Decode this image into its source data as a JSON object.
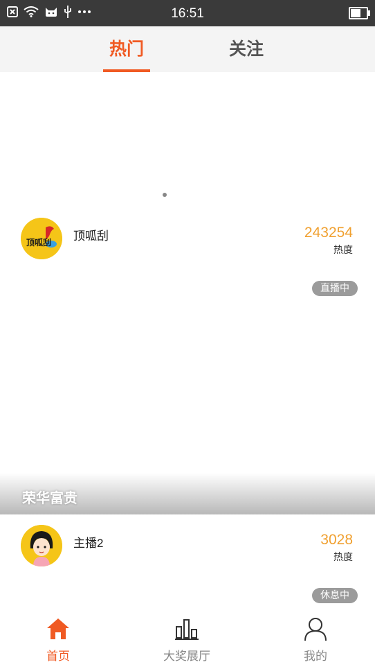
{
  "status_bar": {
    "time": "16:51",
    "icons": [
      "close-box-icon",
      "wifi-icon",
      "cat-icon",
      "usb-icon",
      "more-dots-icon"
    ]
  },
  "tabs": [
    {
      "label": "热门",
      "active": true
    },
    {
      "label": "关注",
      "active": false
    }
  ],
  "colors": {
    "accent": "#f05a23",
    "heat": "#f0a030",
    "badge": "#9b9b9b"
  },
  "streams": [
    {
      "name": "顶呱刮",
      "heat": "243254",
      "heat_label": "热度",
      "status": "直播中",
      "avatar_text": "顶呱刮"
    },
    {
      "name": "主播2",
      "heat": "3028",
      "heat_label": "热度",
      "status": "休息中"
    }
  ],
  "section_title": "荣华富贵",
  "bottom_nav": [
    {
      "label": "首页",
      "icon": "home-icon",
      "active": true
    },
    {
      "label": "大奖展厅",
      "icon": "bar-chart-icon",
      "active": false
    },
    {
      "label": "我的",
      "icon": "user-icon",
      "active": false
    }
  ]
}
